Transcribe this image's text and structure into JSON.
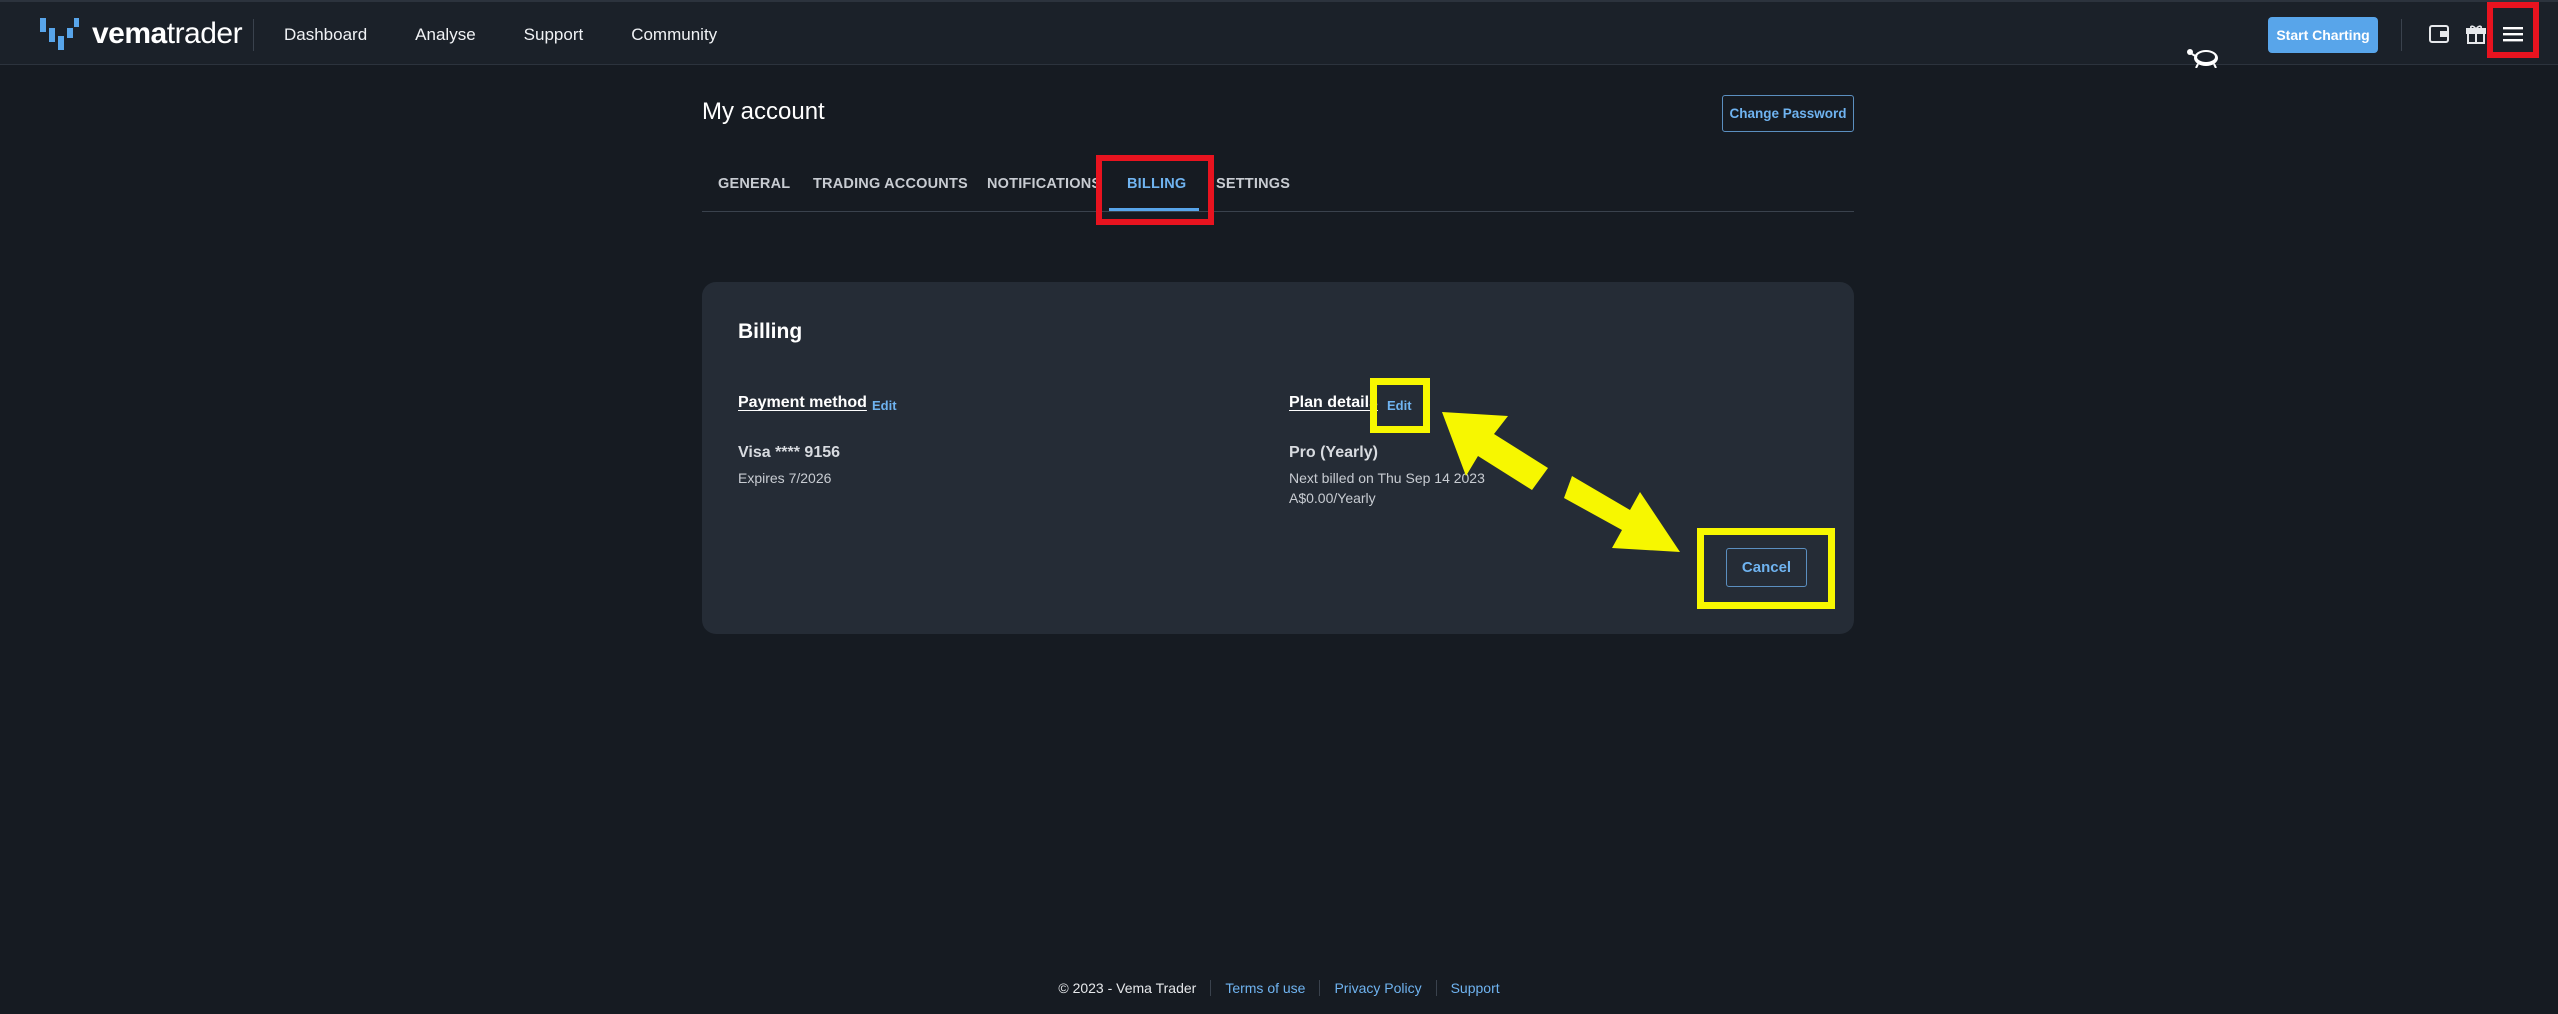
{
  "brand": {
    "name_bold": "vema",
    "name_light": "trader"
  },
  "nav": {
    "links": [
      "Dashboard",
      "Analyse",
      "Support",
      "Community"
    ],
    "start_button": "Start Charting"
  },
  "page": {
    "title": "My account",
    "change_password": "Change Password"
  },
  "tabs": [
    "GENERAL",
    "TRADING ACCOUNTS",
    "NOTIFICATIONS",
    "BILLING",
    "SETTINGS"
  ],
  "active_tab": "BILLING",
  "billing": {
    "title": "Billing",
    "payment": {
      "heading": "Payment method",
      "edit": "Edit",
      "card": "Visa **** 9156",
      "expires": "Expires 7/2026"
    },
    "plan": {
      "heading": "Plan details",
      "edit": "Edit",
      "name": "Pro (Yearly)",
      "next_billed": "Next billed on Thu Sep 14 2023",
      "price": "A$0.00/Yearly"
    },
    "cancel": "Cancel"
  },
  "footer": {
    "copyright": "© 2023 - Vema Trader",
    "links": [
      "Terms of use",
      "Privacy Policy",
      "Support"
    ]
  },
  "colors": {
    "accent": "#58a5ea",
    "annotation_red": "#e8131f",
    "annotation_yellow": "#f7f700"
  }
}
